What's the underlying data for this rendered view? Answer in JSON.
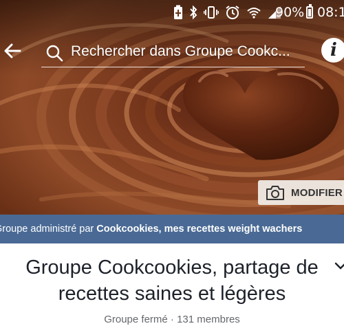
{
  "status_bar": {
    "icons": [
      "battery-saver-icon",
      "bluetooth-icon",
      "vibrate-icon",
      "alarm-icon",
      "wifi-icon",
      "signal-icon"
    ],
    "battery": "90%",
    "time": "08:1"
  },
  "header": {
    "search_text": "Rechercher dans Groupe Cookc..."
  },
  "cover": {
    "edit_label": "MODIFIER"
  },
  "admin_banner": {
    "prefix": "Groupe administré par ",
    "admin_name": "Cookcookies, mes recettes weight wachers"
  },
  "group": {
    "title_line1": "Groupe Cookcookies, partage de",
    "title_line2": "recettes saines et légères",
    "meta": "Groupe fermé · 131 membres"
  },
  "colors": {
    "admin_banner_bg": "#4a6a95",
    "title_text": "#1d2129",
    "meta_text": "#65676b"
  }
}
